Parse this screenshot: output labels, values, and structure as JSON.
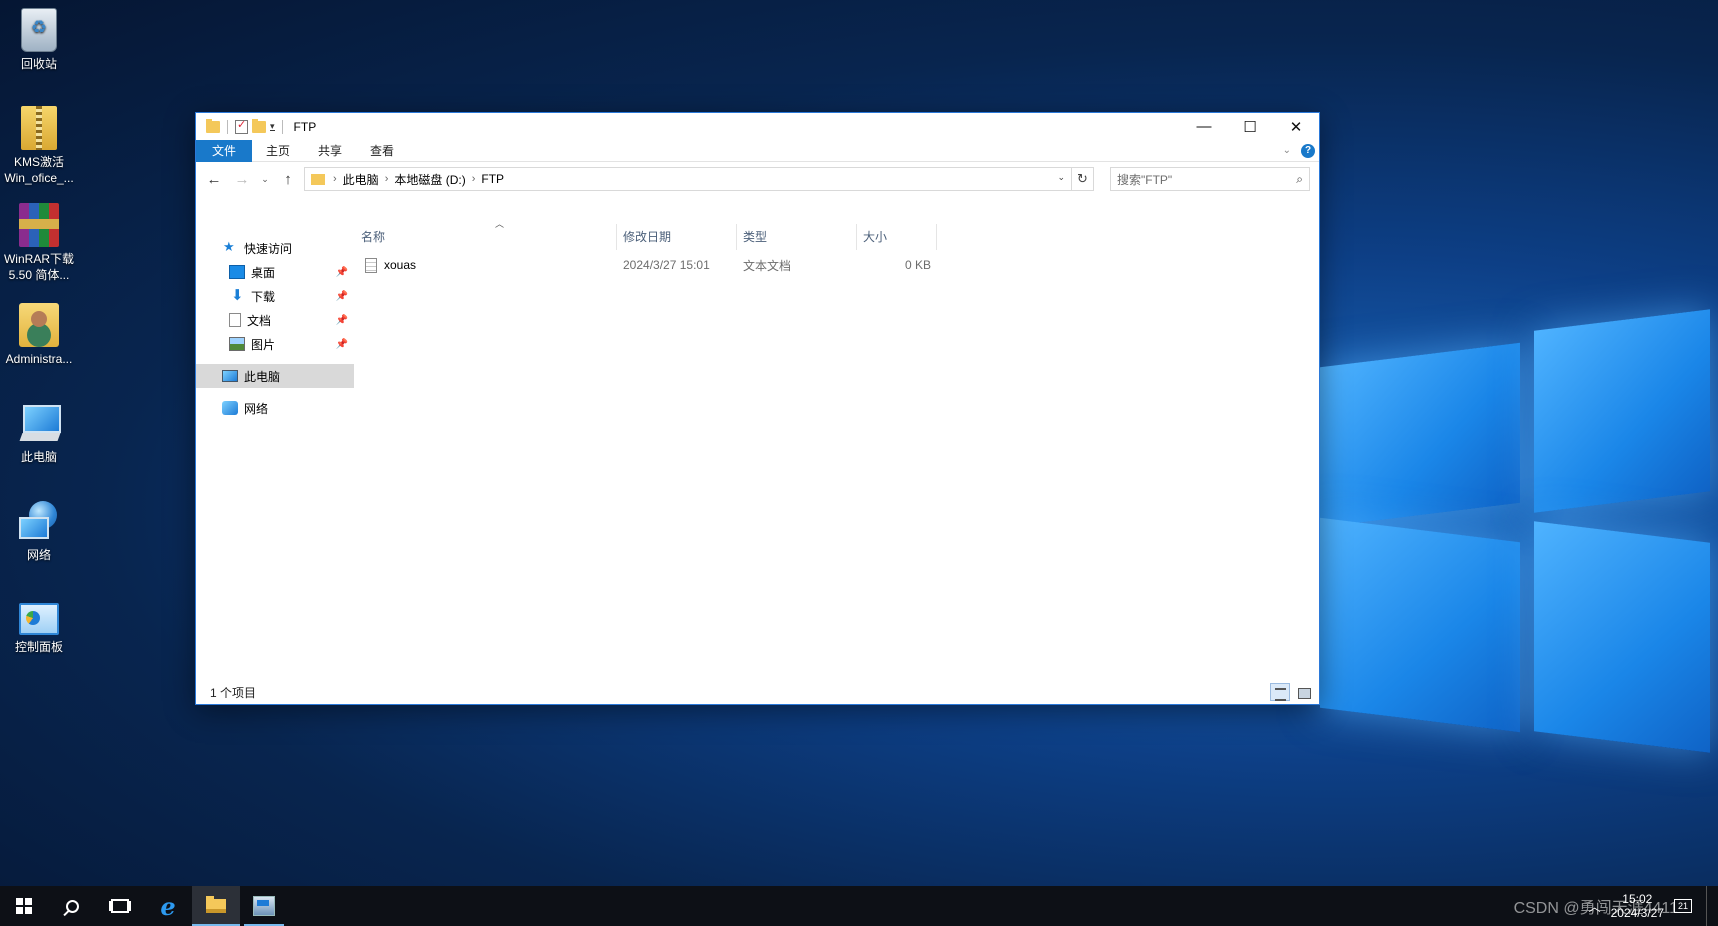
{
  "desktop": {
    "icons": [
      {
        "label": "回收站",
        "icon": "recycle-bin-icon"
      },
      {
        "label": "KMS激活 Win_ofice_...",
        "icon": "zip-archive-icon"
      },
      {
        "label": "WinRAR下载 5.50 简体...",
        "icon": "winrar-icon"
      },
      {
        "label": "Administra...",
        "icon": "user-folder-icon"
      },
      {
        "label": "此电脑",
        "icon": "computer-icon"
      },
      {
        "label": "网络",
        "icon": "network-icon"
      },
      {
        "label": "控制面板",
        "icon": "control-panel-icon"
      }
    ]
  },
  "window": {
    "title": "FTP",
    "controls": {
      "minimize": "—",
      "maximize": "☐",
      "close": "✕"
    },
    "ribbon": {
      "tabs": [
        "文件",
        "主页",
        "共享",
        "查看"
      ],
      "expand": "⌄",
      "help": "?"
    },
    "nav": {
      "back": "←",
      "forward": "→",
      "recent": "⌄",
      "up": "↑"
    },
    "address": {
      "crumbs": [
        "此电脑",
        "本地磁盘 (D:)",
        "FTP"
      ],
      "separator": "›",
      "refresh": "↻"
    },
    "search": {
      "placeholder": "搜索\"FTP\""
    },
    "nav_pane": {
      "quick_access": "快速访问",
      "items": [
        {
          "label": "桌面",
          "icon": "desktop-folder-icon"
        },
        {
          "label": "下载",
          "icon": "downloads-icon"
        },
        {
          "label": "文档",
          "icon": "documents-icon"
        },
        {
          "label": "图片",
          "icon": "pictures-icon"
        }
      ],
      "this_pc": "此电脑",
      "network": "网络"
    },
    "columns": [
      "名称",
      "修改日期",
      "类型",
      "大小"
    ],
    "files": [
      {
        "name": "xouas",
        "modified": "2024/3/27 15:01",
        "type": "文本文档",
        "size": "0 KB"
      }
    ],
    "status": "1 个项目"
  },
  "taskbar": {
    "clock_time": "15:02",
    "clock_date": "2024/3/27",
    "tray_chevron": "︿",
    "notification": "21"
  },
  "watermark": "CSDN @勇闯天涯4411"
}
